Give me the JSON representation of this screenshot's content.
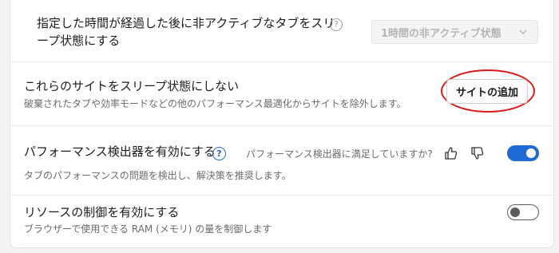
{
  "colors": {
    "accent": "#1f6ad4",
    "highlight_ring": "#d81b1b"
  },
  "sleeping_tabs": {
    "label_line1": "指定した時間が経過した後に非アクティブなタブをスリ",
    "label_line2": "ープ状態にする",
    "help_icon": "question-circle-icon",
    "dropdown_value": "1時間の非アクティブ状態",
    "dropdown_icon": "chevron-down-icon"
  },
  "never_sleep": {
    "label": "これらのサイトをスリープ状態にしない",
    "description": "破棄されたタブや効率モードなどの他のパフォーマンス最適化からサイトを除外します。",
    "add_button_label": "サイトの追加"
  },
  "performance_detector": {
    "label": "パフォーマンス検出器を有効にする",
    "help_icon": "question-circle-icon",
    "feedback_prompt": "パフォーマンス検出器に満足していますか?",
    "thumbs_up_icon": "thumbs-up-icon",
    "thumbs_down_icon": "thumbs-down-icon",
    "enabled": true,
    "description": "タブのパフォーマンスの問題を検出し、解決策を推奨します。"
  },
  "resource_controls": {
    "label": "リソースの制御を有効にする",
    "enabled": false,
    "description": "ブラウザーで使用できる RAM (メモリ) の量を制御します"
  }
}
